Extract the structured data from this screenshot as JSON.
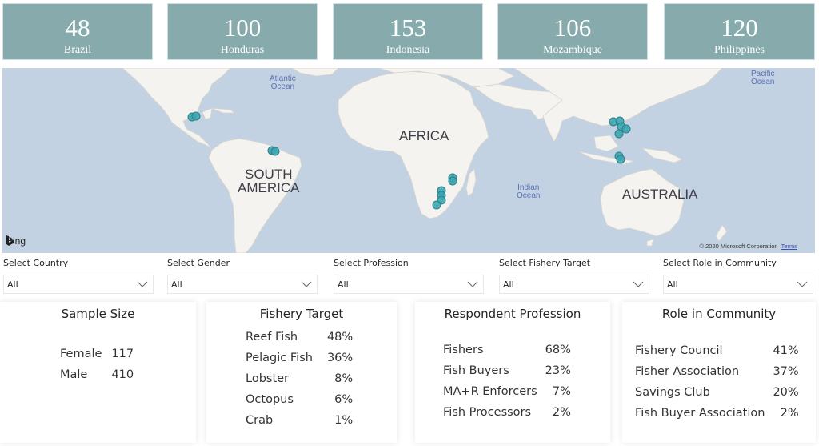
{
  "kpis": [
    {
      "value": "48",
      "label": "Brazil"
    },
    {
      "value": "100",
      "label": "Honduras"
    },
    {
      "value": "153",
      "label": "Indonesia"
    },
    {
      "value": "106",
      "label": "Mozambique"
    },
    {
      "value": "120",
      "label": "Philippines"
    }
  ],
  "map": {
    "labels": {
      "south_america": "SOUTH\nAMERICA",
      "africa": "AFRICA",
      "australia": "AUSTRALIA",
      "atlantic": "Atlantic\nOcean",
      "indian": "Indian\nOcean",
      "pacific": "Pacific\nOcean"
    },
    "bing_label": "Bing",
    "copyright": "© 2020 Microsoft Corporation",
    "terms_link": "Terms",
    "marker_color": "#3ba6b1"
  },
  "filters": [
    {
      "title": "Select Country",
      "value": "All"
    },
    {
      "title": "Select Gender",
      "value": "All"
    },
    {
      "title": "Select Profession",
      "value": "All"
    },
    {
      "title": "Select Fishery Target",
      "value": "All"
    },
    {
      "title": "Select Role in Community",
      "value": "All"
    }
  ],
  "cards": {
    "sample_size": {
      "title": "Sample Size",
      "rows": [
        {
          "label": "Female",
          "value": "117"
        },
        {
          "label": "Male",
          "value": "410"
        }
      ]
    },
    "fishery_target": {
      "title": "Fishery Target",
      "rows": [
        {
          "label": "Reef Fish",
          "value": "48%"
        },
        {
          "label": "Pelagic Fish",
          "value": "36%"
        },
        {
          "label": "Lobster",
          "value": "8%"
        },
        {
          "label": "Octopus",
          "value": "6%"
        },
        {
          "label": "Crab",
          "value": "1%"
        }
      ]
    },
    "respondent_profession": {
      "title": "Respondent Profession",
      "rows": [
        {
          "label": "Fishers",
          "value": "68%"
        },
        {
          "label": "Fish Buyers",
          "value": "23%"
        },
        {
          "label": "MA+R Enforcers",
          "value": "7%"
        },
        {
          "label": "Fish Processors",
          "value": "2%"
        }
      ]
    },
    "role_in_community": {
      "title": "Role in Community",
      "rows": [
        {
          "label": "Fishery Council",
          "value": "41%"
        },
        {
          "label": "Fisher Association",
          "value": "37%"
        },
        {
          "label": "Savings Club",
          "value": "20%"
        },
        {
          "label": "Fish Buyer Association",
          "value": "2%"
        }
      ]
    }
  },
  "colors": {
    "kpi_bg": "#87abad",
    "ocean": "#c2d2e2",
    "land": "#f5f3ef"
  }
}
